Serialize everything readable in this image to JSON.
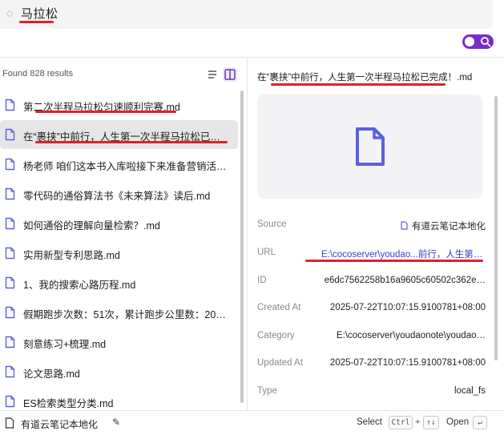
{
  "search": {
    "query": "马拉松"
  },
  "toggle": {
    "accent": "#7a2cc8",
    "icon": "search-icon"
  },
  "results": {
    "found_prefix": "Found",
    "count": "828",
    "found_suffix": "results",
    "items": [
      {
        "label": "第二次半程马拉松匀速顺利完赛.md",
        "icon": "file-icon"
      },
      {
        "label": "在“裹挟”中前行，人生第一次半程马拉松已完成！.md",
        "icon": "file-icon",
        "selected": true
      },
      {
        "label": "杨老师 咱们这本书入库啦接下来准备营销活动吧.md",
        "icon": "file-icon"
      },
      {
        "label": "零代码的通俗算法书《未来算法》读后.md",
        "icon": "file-icon"
      },
      {
        "label": "如何通俗的理解向量检索？.md",
        "icon": "file-icon"
      },
      {
        "label": "实用新型专利思路.md",
        "icon": "file-icon"
      },
      {
        "label": "1、我的搜索心路历程.md",
        "icon": "file-icon"
      },
      {
        "label": "假期跑步次数：51次，累计跑步公里数：2025.md",
        "icon": "file-icon"
      },
      {
        "label": "刻意练习+梳理.md",
        "icon": "file-icon"
      },
      {
        "label": "论文思路.md",
        "icon": "file-icon"
      },
      {
        "label": "ES检索类型分类.md",
        "icon": "file-icon"
      }
    ]
  },
  "detail": {
    "title": "在“裹挟”中前行，人生第一次半程马拉松已完成！.md",
    "fields": {
      "source": {
        "key": "Source",
        "value": "有道云笔记本地化"
      },
      "url": {
        "key": "URL",
        "value": "E:\\cocoserver\\youdao...前行，人生第一次半程马拉松已完成！.md"
      },
      "id": {
        "key": "ID",
        "value": "e6dc7562258b16a9605c60502c362e…"
      },
      "created": {
        "key": "Created At",
        "value": "2025-07-22T10:07:15.9100781+08:00"
      },
      "category": {
        "key": "Category",
        "value": "E:\\cocoserver\\youdaonote\\youdao…"
      },
      "updated": {
        "key": "Updated At",
        "value": "2025-07-22T10:07:15.9100781+08:00"
      },
      "type": {
        "key": "Type",
        "value": "local_fs"
      }
    }
  },
  "footer": {
    "source_name": "有道云笔记本地化",
    "select_label": "Select",
    "ctrl_key": "Ctrl",
    "plus": "+",
    "arrows_key": "↑↓",
    "open_label": "Open",
    "enter_key": "↵"
  },
  "colors": {
    "accent": "#7a2cc8",
    "file_icon": "#5b5fe0",
    "annotation": "#e0202a",
    "link": "#3a40c8"
  }
}
